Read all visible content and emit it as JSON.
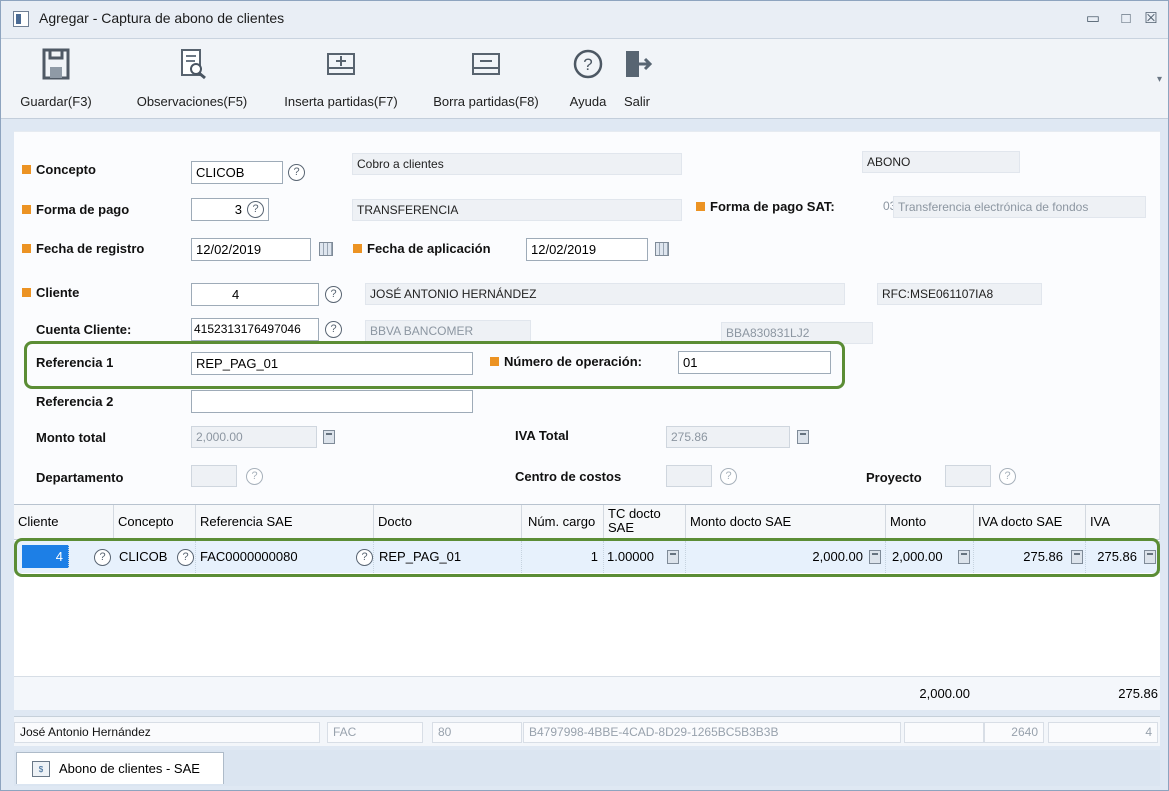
{
  "window": {
    "title": "Agregar - Captura de abono de clientes",
    "minimize_glyph": "▭",
    "maximize_glyph": "□",
    "close_glyph": "☒"
  },
  "toolbar": {
    "items": [
      {
        "label": "Guardar(F3)",
        "icon": "save-icon"
      },
      {
        "label": "Observaciones(F5)",
        "icon": "notes-icon"
      },
      {
        "label": "Inserta partidas(F7)",
        "icon": "insert-rows-icon"
      },
      {
        "label": "Borra partidas(F8)",
        "icon": "delete-rows-icon"
      },
      {
        "label": "Ayuda",
        "icon": "help-icon"
      },
      {
        "label": "Salir",
        "icon": "exit-icon"
      }
    ],
    "overflow_glyph": "▾"
  },
  "form": {
    "concepto": {
      "label": "Concepto",
      "value": "CLICOB",
      "description": "Cobro a clientes",
      "tipo": "ABONO"
    },
    "forma_pago": {
      "label": "Forma de pago",
      "value": "3",
      "description": "TRANSFERENCIA"
    },
    "forma_pago_sat": {
      "label": "Forma de pago SAT:",
      "code": "03",
      "description": "Transferencia electrónica de fondos"
    },
    "fecha_registro": {
      "label": "Fecha de registro",
      "value": "12/02/2019"
    },
    "fecha_aplicacion": {
      "label": "Fecha de aplicación",
      "value": "12/02/2019"
    },
    "cliente": {
      "label": "Cliente",
      "value": "4",
      "name": "JOSÉ ANTONIO HERNÁNDEZ",
      "rfc": "RFC:MSE061107IA8"
    },
    "cuenta_cliente": {
      "label": "Cuenta Cliente:",
      "value": "4152313176497046",
      "bank": "BBVA BANCOMER",
      "bank_rfc": "BBA830831LJ2"
    },
    "referencia1": {
      "label": "Referencia 1",
      "value": "REP_PAG_01"
    },
    "numero_operacion": {
      "label": "Número de operación:",
      "value": "01"
    },
    "referencia2": {
      "label": "Referencia 2",
      "value": ""
    },
    "monto_total": {
      "label": "Monto total",
      "value": "2,000.00"
    },
    "iva_total": {
      "label": "IVA Total",
      "value": "275.86"
    },
    "departamento": {
      "label": "Departamento",
      "value": ""
    },
    "centro_costos": {
      "label": "Centro de costos",
      "value": ""
    },
    "proyecto": {
      "label": "Proyecto",
      "value": ""
    },
    "help_glyph": "?"
  },
  "grid": {
    "columns": [
      "Cliente",
      "Concepto",
      "Referencia SAE",
      "Docto",
      "Núm. cargo",
      "TC docto SAE",
      "Monto docto SAE",
      "Monto",
      "IVA docto SAE",
      "IVA"
    ],
    "rows": [
      {
        "cliente": "4",
        "concepto": "CLICOB",
        "referencia_sae": "FAC0000000080",
        "docto": "REP_PAG_01",
        "num_cargo": "1",
        "tc_docto_sae": "1.00000",
        "monto_docto_sae": "2,000.00",
        "monto": "2,000.00",
        "iva_docto_sae": "275.86",
        "iva": "275.86"
      }
    ],
    "totals": {
      "monto": "2,000.00",
      "iva": "275.86"
    }
  },
  "statusbar": {
    "client_name": "José Antonio Hernández",
    "doc_type": "FAC",
    "doc_number": "80",
    "uuid": "B4797998-4BBE-4CAD-8D29-1265BC5B3B3B",
    "blank": "",
    "number": "2640",
    "tail": "4"
  },
  "tabs": [
    {
      "label": "Abono de clientes - SAE",
      "icon_glyph": "$"
    }
  ]
}
